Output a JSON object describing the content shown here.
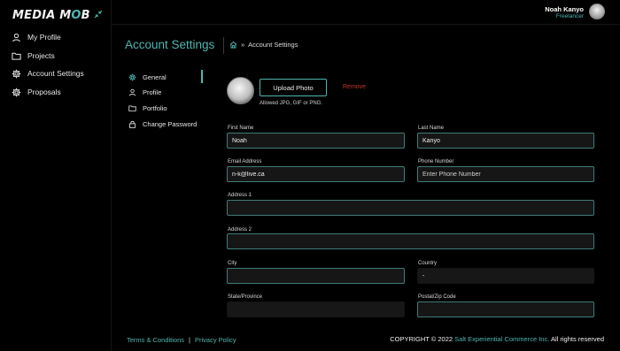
{
  "brand": {
    "logo_prefix": "MEDIA M",
    "logo_highlight": "O",
    "logo_suffix": "B"
  },
  "sidebar": {
    "items": [
      {
        "label": "My Profile",
        "icon": "user-icon"
      },
      {
        "label": "Projects",
        "icon": "folder-icon"
      },
      {
        "label": "Account Settings",
        "icon": "gear-icon"
      },
      {
        "label": "Proposals",
        "icon": "gear-icon"
      }
    ]
  },
  "user": {
    "name": "Noah Kanyo",
    "role": "Freelancer"
  },
  "page": {
    "title": "Account Settings",
    "breadcrumb": "Account Settings"
  },
  "tabs": [
    {
      "label": "General",
      "icon": "gear-icon"
    },
    {
      "label": "Profile",
      "icon": "user-icon"
    },
    {
      "label": "Portfolio",
      "icon": "folder-icon"
    },
    {
      "label": "Change Password",
      "icon": "lock-icon"
    }
  ],
  "photo": {
    "upload_label": "Upload Photo",
    "remove_label": "Remove",
    "allowed_text": "Allowed JPG, GIF or PNG."
  },
  "form": {
    "first_name": {
      "label": "First Name",
      "value": "Noah"
    },
    "last_name": {
      "label": "Last Name",
      "value": "Kanyo"
    },
    "email": {
      "label": "Email Address",
      "value": "n-k@live.ca"
    },
    "phone": {
      "label": "Phone Number",
      "value": "",
      "placeholder": "Enter Phone Number"
    },
    "address1": {
      "label": "Address 1",
      "value": ""
    },
    "address2": {
      "label": "Address 2",
      "value": ""
    },
    "city": {
      "label": "City",
      "value": ""
    },
    "country": {
      "label": "Country",
      "value": "-"
    },
    "state": {
      "label": "State/Province",
      "value": ""
    },
    "postal": {
      "label": "Postal/Zip Code",
      "value": ""
    }
  },
  "footer": {
    "terms": "Terms & Conditions",
    "separator": "|",
    "privacy": "Privacy Policy",
    "copyright_prefix": "COPYRIGHT © 2022",
    "company": "Salt Experiential Commerce Inc.",
    "rights": "All rights reserved"
  },
  "colors": {
    "accent": "#4fb6b0",
    "danger": "#c0392b",
    "background": "#000000",
    "field_bg": "#161616"
  }
}
